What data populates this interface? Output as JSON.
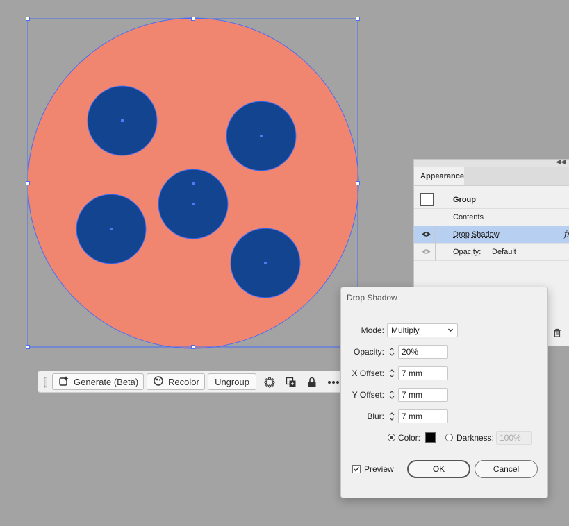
{
  "colors": {
    "canvas": "#a3a3a3",
    "big_circle": "#f08670",
    "small_circle": "#12448f",
    "selection": "#4a6cf7",
    "selected_row": "#b7cff0"
  },
  "taskbar": {
    "generate_label": "Generate (Beta)",
    "recolor_label": "Recolor",
    "ungroup_label": "Ungroup",
    "icons": [
      "sparkle-generate-icon",
      "recolor-icon",
      "transform-icon",
      "duplicate-icon",
      "lock-icon",
      "more-icon"
    ]
  },
  "appearance": {
    "tab": "Appearance",
    "rows": {
      "group": "Group",
      "contents": "Contents",
      "drop_shadow": "Drop Shadow",
      "fx": "fx",
      "opacity_label": "Opacity:",
      "opacity_value": "Default"
    }
  },
  "dialog": {
    "title": "Drop Shadow",
    "mode_label": "Mode:",
    "mode_value": "Multiply",
    "opacity_label": "Opacity:",
    "opacity_value": "20%",
    "x_label": "X Offset:",
    "x_value": "7 mm",
    "y_label": "Y Offset:",
    "y_value": "7 mm",
    "blur_label": "Blur:",
    "blur_value": "7 mm",
    "color_label": "Color:",
    "darkness_label": "Darkness:",
    "darkness_value": "100%",
    "preview_label": "Preview",
    "ok_label": "OK",
    "cancel_label": "Cancel",
    "color_selected": true,
    "preview_checked": true
  }
}
